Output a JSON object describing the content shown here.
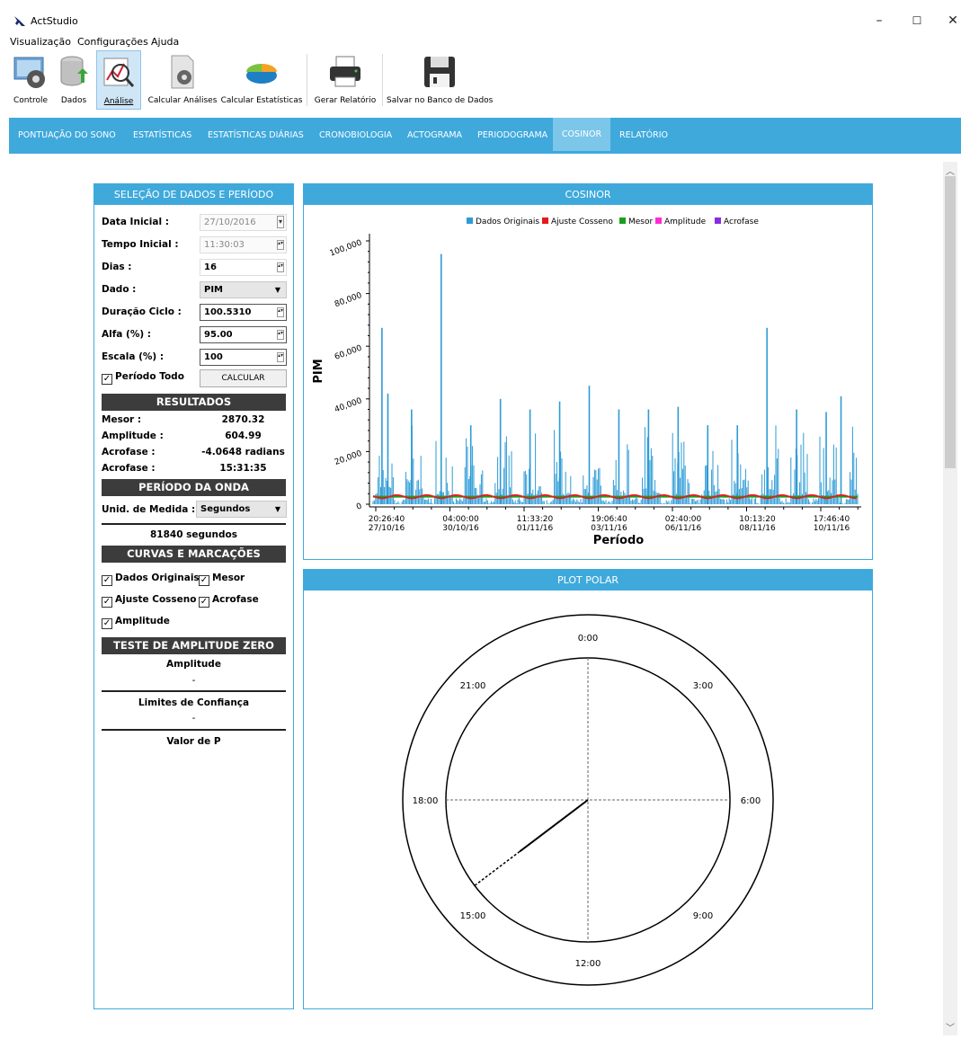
{
  "window": {
    "title": "ActStudio",
    "minimize": "–",
    "maximize": "☐",
    "close": "✕"
  },
  "menu": [
    "Visualização",
    "Configurações",
    "Ajuda"
  ],
  "toolbar": [
    {
      "label": "Controle",
      "icon": "gear-monitor-icon"
    },
    {
      "label": "Dados",
      "icon": "database-icon"
    },
    {
      "label": "Análise",
      "icon": "analysis-icon",
      "active": true
    },
    {
      "label": "Calcular Análises",
      "icon": "document-gear-icon"
    },
    {
      "label": "Calcular Estatísticas",
      "icon": "pie-chart-icon"
    },
    {
      "label": "Gerar Relatório",
      "icon": "printer-icon"
    },
    {
      "label": "Salvar no Banco de Dados",
      "icon": "floppy-disk-icon"
    }
  ],
  "tabs": [
    "PONTUAÇÃO DO SONO",
    "ESTATÍSTICAS",
    "ESTATÍSTICAS DIÁRIAS",
    "CRONOBIOLOGIA",
    "ACTOGRAMA",
    "PERIODOGRAMA",
    "COSINOR",
    "RELATÓRIO"
  ],
  "active_tab": "COSINOR",
  "left_panel": {
    "title": "SELEÇÃO DE DADOS E PERÍODO",
    "fields": {
      "data_inicial": {
        "label": "Data Inicial :",
        "value": "27/10/2016"
      },
      "tempo_inicial": {
        "label": "Tempo Inicial :",
        "value": "11:30:03"
      },
      "dias": {
        "label": "Dias :",
        "value": "16"
      },
      "dado": {
        "label": "Dado :",
        "value": "PIM"
      },
      "duracao_ciclo": {
        "label": "Duração Ciclo :",
        "value": "100.5310"
      },
      "alfa": {
        "label": "Alfa (%) :",
        "value": "95.00"
      },
      "escala": {
        "label": "Escala (%) :",
        "value": "100"
      }
    },
    "periodo_todo": "Período Todo",
    "calcular": "CALCULAR",
    "resultados": {
      "title": "RESULTADOS",
      "rows": [
        {
          "label": "Mesor :",
          "value": "2870.32"
        },
        {
          "label": "Amplitude :",
          "value": "604.99"
        },
        {
          "label": "Acrofase :",
          "value": "-4.0648 radians"
        },
        {
          "label": "Acrofase :",
          "value": "15:31:35"
        }
      ]
    },
    "periodo_onda": {
      "title": "PERÍODO DA ONDA",
      "unit_label": "Unid. de Medida :",
      "unit_value": "Segundos",
      "result": "81840 segundos"
    },
    "curvas": {
      "title": "CURVAS E MARCAÇÕES",
      "items": {
        "dados_originais": "Dados Originais",
        "mesor": "Mesor",
        "ajuste_cosseno": "Ajuste Cosseno",
        "acrofase": "Acrofase",
        "amplitude": "Amplitude"
      }
    },
    "teste": {
      "title": "TESTE DE AMPLITUDE ZERO",
      "amplitude_label": "Amplitude",
      "amplitude_value": "-",
      "limites_label": "Limites de Confiança",
      "limites_value": "-",
      "valor_p_label": "Valor de P"
    }
  },
  "cosinor_panel": {
    "title": "COSINOR"
  },
  "polar_panel": {
    "title": "PLOT POLAR"
  },
  "chart_data": [
    {
      "type": "bar",
      "title": "",
      "xlabel": "Período",
      "ylabel": "PIM",
      "ylim": [
        0,
        100000
      ],
      "y_ticks": [
        "0",
        "20,000",
        "40,000",
        "60,000",
        "80,000",
        "100,000"
      ],
      "x_ticks": [
        {
          "time": "20:26:40",
          "date": "27/10/16"
        },
        {
          "time": "04:00:00",
          "date": "30/10/16"
        },
        {
          "time": "11:33:20",
          "date": "01/11/16"
        },
        {
          "time": "19:06:40",
          "date": "03/11/16"
        },
        {
          "time": "02:40:00",
          "date": "06/11/16"
        },
        {
          "time": "10:13:20",
          "date": "08/11/16"
        },
        {
          "time": "17:46:40",
          "date": "10/11/16"
        }
      ],
      "legend_position": "top",
      "series": [
        {
          "name": "Dados Originais",
          "color": "#2e9bd6"
        },
        {
          "name": "Ajuste Cosseno",
          "color": "#e31a1c"
        },
        {
          "name": "Mesor",
          "color": "#1a9e1a"
        },
        {
          "name": "Amplitude",
          "color": "#ff2bd6"
        },
        {
          "name": "Acrofase",
          "color": "#8a2be2"
        }
      ],
      "activity_peaks": [
        {
          "day": 0.3,
          "value": 67000
        },
        {
          "day": 0.5,
          "value": 42000
        },
        {
          "day": 1.3,
          "value": 36000
        },
        {
          "day": 2.3,
          "value": 95000
        },
        {
          "day": 3.3,
          "value": 30000
        },
        {
          "day": 4.3,
          "value": 40000
        },
        {
          "day": 5.3,
          "value": 36000
        },
        {
          "day": 6.3,
          "value": 39000
        },
        {
          "day": 7.3,
          "value": 45000
        },
        {
          "day": 8.3,
          "value": 36000
        },
        {
          "day": 9.3,
          "value": 36000
        },
        {
          "day": 10.3,
          "value": 37000
        },
        {
          "day": 11.3,
          "value": 30000
        },
        {
          "day": 12.3,
          "value": 30000
        },
        {
          "day": 13.3,
          "value": 67000
        },
        {
          "day": 14.3,
          "value": 36000
        },
        {
          "day": 15.3,
          "value": 35000
        },
        {
          "day": 15.8,
          "value": 41000
        }
      ],
      "mesor": 2870.32,
      "amplitude": 604.99
    },
    {
      "type": "polar",
      "title": "",
      "hour_labels": [
        "0:00",
        "3:00",
        "6:00",
        "9:00",
        "12:00",
        "15:00",
        "18:00",
        "21:00"
      ],
      "acrophase_time": "15:31:35",
      "acrophase_radians": -4.0648
    }
  ],
  "colors": {
    "accent": "#3fa9dc",
    "dark_header": "#3c3c3c"
  }
}
